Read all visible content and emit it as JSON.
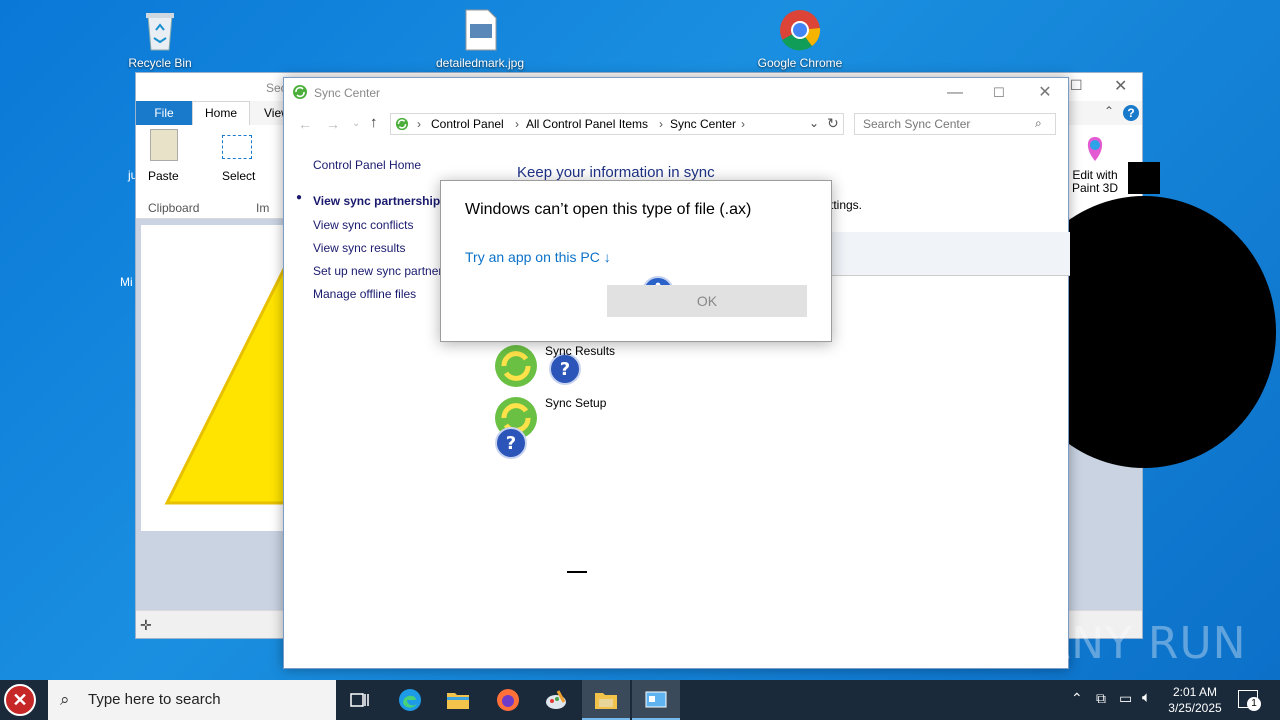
{
  "desktop": {
    "icons": [
      {
        "label": "Recycle Bin"
      },
      {
        "label": "detailedmark.jpg"
      },
      {
        "label": "Google Chrome"
      }
    ],
    "partial_labels": [
      "ju",
      "Mi"
    ]
  },
  "paint": {
    "tabs": {
      "file": "File",
      "home": "Home",
      "view": "View"
    },
    "title_partial": "Sec",
    "ribbon": {
      "paste": "Paste",
      "select": "Select",
      "clipboard": "Clipboard",
      "image_partial": "Im",
      "edit_paint3d": "Edit with Paint 3D"
    },
    "help": "?"
  },
  "sync": {
    "title": "Sync Center",
    "breadcrumb": [
      "Control Panel",
      "All Control Panel Items",
      "Sync Center"
    ],
    "search_placeholder": "Search Sync Center",
    "nav": {
      "home": "Control Panel Home",
      "partnerships": "View sync partnerships",
      "conflicts": "View sync conflicts",
      "results": "View sync results",
      "setup": "Set up new sync partner",
      "offline": "Manage offline files"
    },
    "heading": "Keep your information in sync",
    "partial_text": "ttings.",
    "items": [
      {
        "label": "Sync Results"
      },
      {
        "label": "Sync Setup"
      }
    ]
  },
  "dialog": {
    "message": "Windows can’t open this type of file (.ax)",
    "link": "Try an app on this PC ↓",
    "ok": "OK"
  },
  "taskbar": {
    "search_placeholder": "Type here to search",
    "time": "2:01 AM",
    "date": "3/25/2025",
    "notification_count": "1"
  },
  "watermark": "ANY RUN"
}
